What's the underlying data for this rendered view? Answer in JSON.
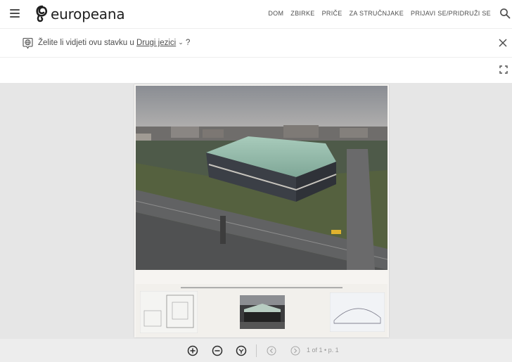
{
  "header": {
    "logo_text": "europeana",
    "nav": [
      "DOM",
      "ZBIRKE",
      "PRIČE",
      "ZA STRUČNJAKE",
      "PRIJAVI SE/PRIDRUŽI SE"
    ]
  },
  "lang_bar": {
    "prompt_prefix": "Želite li vidjeti ovu stavku u ",
    "link_text": "Drugi jezici",
    "prompt_suffix": " ?"
  },
  "viewer": {
    "page_info": "1 of 1 • p. 1"
  },
  "colors": {
    "accent": "#1f1f1f",
    "viewer_bg": "#e6e6e6",
    "controls_bg": "#ededed"
  }
}
